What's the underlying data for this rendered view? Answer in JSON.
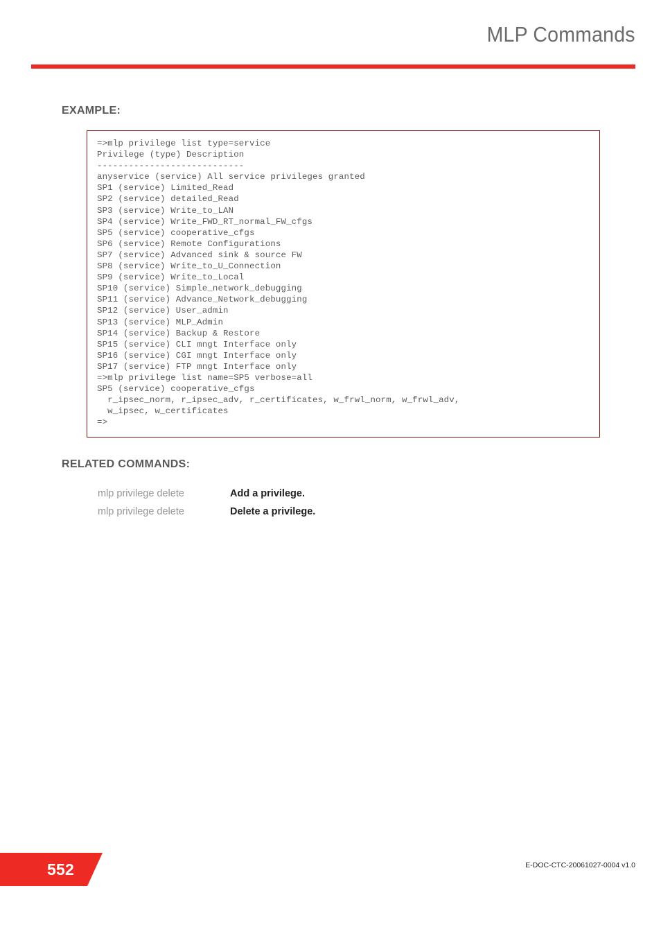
{
  "header": {
    "title": "MLP Commands",
    "rule_color": "#ee2a24"
  },
  "sections": {
    "example_heading": "EXAMPLE:",
    "related_heading": "RELATED COMMANDS:"
  },
  "code_block": {
    "border_color": "#7c1210",
    "text": "=>mlp privilege list type=service\nPrivilege (type) Description\n----------------------------\nanyservice (service) All service privileges granted\nSP1 (service) Limited_Read\nSP2 (service) detailed_Read\nSP3 (service) Write_to_LAN\nSP4 (service) Write_FWD_RT_normal_FW_cfgs\nSP5 (service) cooperative_cfgs\nSP6 (service) Remote Configurations\nSP7 (service) Advanced sink & source FW\nSP8 (service) Write_to_U_Connection\nSP9 (service) Write_to_Local\nSP10 (service) Simple_network_debugging\nSP11 (service) Advance_Network_debugging\nSP12 (service) User_admin\nSP13 (service) MLP_Admin\nSP14 (service) Backup & Restore\nSP15 (service) CLI mngt Interface only\nSP16 (service) CGI mngt Interface only\nSP17 (service) FTP mngt Interface only\n=>mlp privilege list name=SP5 verbose=all\nSP5 (service) cooperative_cfgs\n  r_ipsec_norm, r_ipsec_adv, r_certificates, w_frwl_norm, w_frwl_adv,\n  w_ipsec, w_certificates\n=>",
    "lines": [
      "=>mlp privilege list type=service",
      "Privilege (type) Description",
      "----------------------------",
      "anyservice (service) All service privileges granted",
      "SP1 (service) Limited_Read",
      "SP2 (service) detailed_Read",
      "SP3 (service) Write_to_LAN",
      "SP4 (service) Write_FWD_RT_normal_FW_cfgs",
      "SP5 (service) cooperative_cfgs",
      "SP6 (service) Remote Configurations",
      "SP7 (service) Advanced sink & source FW",
      "SP8 (service) Write_to_U_Connection",
      "SP9 (service) Write_to_Local",
      "SP10 (service) Simple_network_debugging",
      "SP11 (service) Advance_Network_debugging",
      "SP12 (service) User_admin",
      "SP13 (service) MLP_Admin",
      "SP14 (service) Backup & Restore",
      "SP15 (service) CLI mngt Interface only",
      "SP16 (service) CGI mngt Interface only",
      "SP17 (service) FTP mngt Interface only",
      "=>mlp privilege list name=SP5 verbose=all",
      "SP5 (service) cooperative_cfgs",
      "  r_ipsec_norm, r_ipsec_adv, r_certificates, w_frwl_norm, w_frwl_adv,",
      "  w_ipsec, w_certificates",
      "=>"
    ]
  },
  "related_commands": [
    {
      "command": "mlp privilege delete",
      "description": "Add a privilege."
    },
    {
      "command": "mlp privilege delete",
      "description": "Delete a privilege."
    }
  ],
  "footer": {
    "page_number": "552",
    "document_id": "E-DOC-CTC-20061027-0004 v1.0",
    "tab_color": "#ee2a24"
  }
}
